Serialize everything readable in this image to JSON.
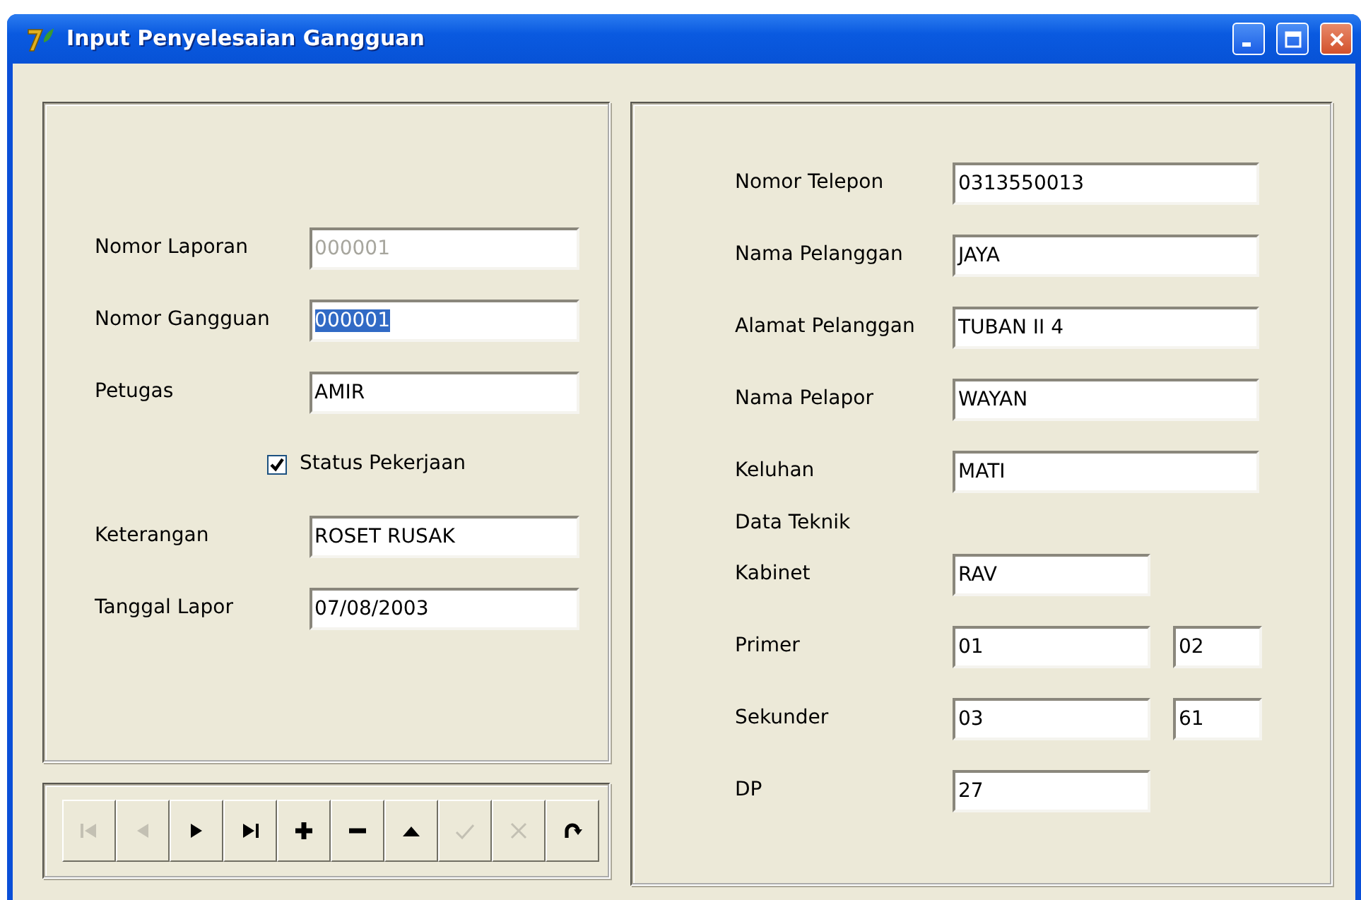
{
  "window": {
    "title": "Input Penyelesaian Gangguan"
  },
  "report_fields": [
    {
      "label": "Nomor Laporan",
      "value": "000001",
      "disabled": true,
      "selected": false
    },
    {
      "label": "Nomor Gangguan",
      "value": "000001",
      "disabled": false,
      "selected": true
    },
    {
      "label": "Petugas",
      "value": "AMIR",
      "disabled": false,
      "selected": false
    }
  ],
  "status_checkbox": {
    "label": "Status Pekerjaan",
    "checked": true
  },
  "detail_fields": [
    {
      "label": "Keterangan",
      "value": "ROSET RUSAK",
      "disabled": false,
      "selected": false
    },
    {
      "label": "Tanggal Lapor",
      "value": "07/08/2003",
      "disabled": false,
      "selected": false
    }
  ],
  "navigator": [
    {
      "kind": "first",
      "disabled": true
    },
    {
      "kind": "prior",
      "disabled": true
    },
    {
      "kind": "next",
      "disabled": false
    },
    {
      "kind": "last",
      "disabled": false
    },
    {
      "kind": "insert",
      "disabled": false
    },
    {
      "kind": "delete",
      "disabled": false
    },
    {
      "kind": "edit",
      "disabled": false
    },
    {
      "kind": "post",
      "disabled": true
    },
    {
      "kind": "cancel",
      "disabled": true
    },
    {
      "kind": "refresh",
      "disabled": false
    }
  ],
  "customer_fields": [
    {
      "label": "Nomor Telepon",
      "value": "0313550013"
    },
    {
      "label": "Nama Pelanggan",
      "value": "JAYA"
    },
    {
      "label": "Alamat Pelanggan",
      "value": "TUBAN II 4"
    },
    {
      "label": "Nama Pelapor",
      "value": "WAYAN"
    },
    {
      "label": "Keluhan",
      "value": "MATI"
    }
  ],
  "technical_heading": "Data Teknik",
  "technical_fields": [
    {
      "label": "Kabinet",
      "values": [
        "RAV"
      ]
    },
    {
      "label": "Primer",
      "values": [
        "01",
        "02"
      ]
    },
    {
      "label": "Sekunder",
      "values": [
        "03",
        "61"
      ]
    },
    {
      "label": "DP",
      "values": [
        "27"
      ]
    }
  ]
}
